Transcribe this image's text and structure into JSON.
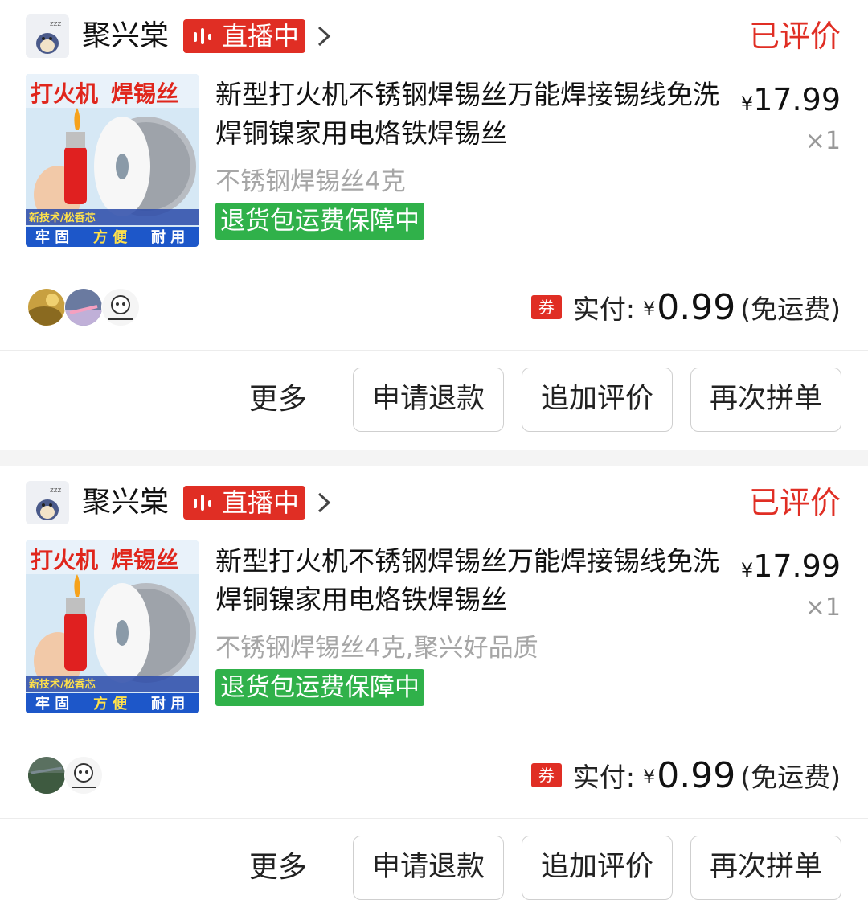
{
  "orders": [
    {
      "shop_name": "聚兴棠",
      "live_label": "直播中",
      "status": "已评价",
      "product": {
        "image_text_top_1": "打火机",
        "image_text_top_2": "焊锡丝",
        "image_text_mid": "新技术/松香芯",
        "image_text_bottom": [
          "牢 固",
          "方 便",
          "耐 用"
        ],
        "title": "新型打火机不锈钢焊锡丝万能焊接锡线免洗焊铜镍家用电烙铁焊锡丝",
        "price_symbol": "¥",
        "price": "17.99",
        "quantity": "×1",
        "spec": "不锈钢焊锡丝4克",
        "tag": "退货包运费保障中"
      },
      "payment": {
        "coupon_label": "券",
        "label": "实付:",
        "currency": "¥",
        "amount": "0.99",
        "note": "(免运费)"
      },
      "actions": {
        "more": "更多",
        "refund": "申请退款",
        "add_review": "追加评价",
        "reorder": "再次拼单"
      }
    },
    {
      "shop_name": "聚兴棠",
      "live_label": "直播中",
      "status": "已评价",
      "product": {
        "image_text_top_1": "打火机",
        "image_text_top_2": "焊锡丝",
        "image_text_mid": "新技术/松香芯",
        "image_text_bottom": [
          "牢 固",
          "方 便",
          "耐 用"
        ],
        "title": "新型打火机不锈钢焊锡丝万能焊接锡线免洗焊铜镍家用电烙铁焊锡丝",
        "price_symbol": "¥",
        "price": "17.99",
        "quantity": "×1",
        "spec": "不锈钢焊锡丝4克,聚兴好品质",
        "tag": "退货包运费保障中"
      },
      "payment": {
        "coupon_label": "券",
        "label": "实付:",
        "currency": "¥",
        "amount": "0.99",
        "note": "(免运费)"
      },
      "actions": {
        "more": "更多",
        "refund": "申请退款",
        "add_review": "追加评价",
        "reorder": "再次拼单"
      }
    }
  ],
  "colors": {
    "brand_red": "#e02e24",
    "tag_green": "#30b14a",
    "muted_text": "#a6a6a6",
    "separator": "#f4f4f4"
  },
  "icons": [
    "shop-avatar-icon",
    "live-audio-icon",
    "chevron-right-icon",
    "product-thumbnail",
    "buyer-avatar",
    "coupon-icon"
  ]
}
